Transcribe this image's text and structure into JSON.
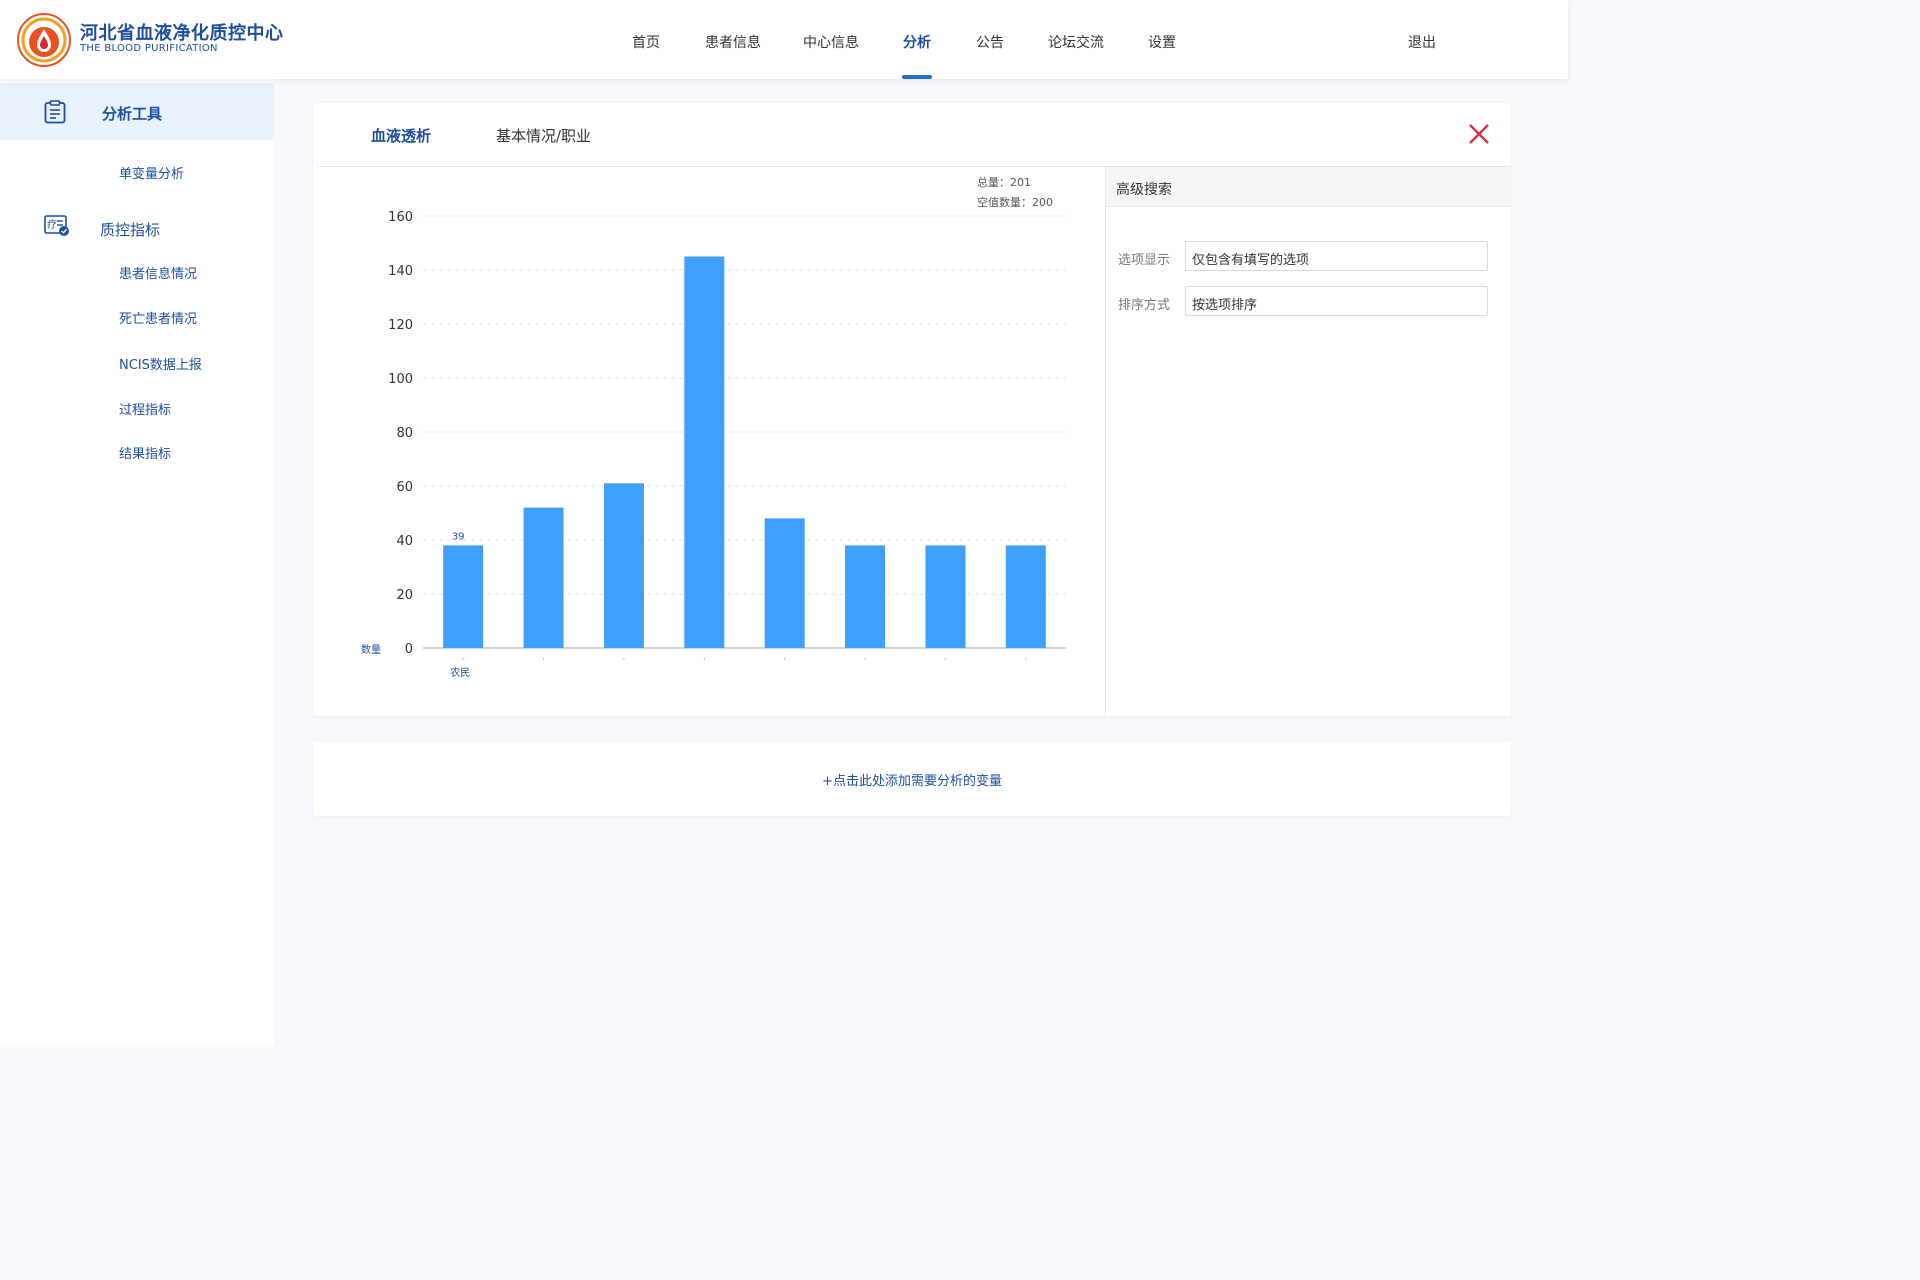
{
  "brand": {
    "name_cn": "河北省血液净化质控中心",
    "name_en": "THE BLOOD PURIFICATION"
  },
  "nav": {
    "items": [
      {
        "label": "首页"
      },
      {
        "label": "患者信息"
      },
      {
        "label": "中心信息"
      },
      {
        "label": "分析"
      },
      {
        "label": "公告"
      },
      {
        "label": "论坛交流"
      },
      {
        "label": "设置"
      }
    ],
    "active": "分析",
    "logout": "退出"
  },
  "sidebar": {
    "tools_title": "分析工具",
    "tools_items": [
      {
        "label": "单变量分析"
      }
    ],
    "qc_title": "质控指标",
    "qc_items": [
      {
        "label": "患者信息情况"
      },
      {
        "label": "死亡患者情况"
      },
      {
        "label": "NCIS数据上报"
      },
      {
        "label": "过程指标"
      },
      {
        "label": "结果指标"
      }
    ]
  },
  "card": {
    "tabs": [
      {
        "label": "血液透析"
      },
      {
        "label": "基本情况/职业"
      }
    ],
    "active_tab": "血液透析",
    "stats": {
      "total": "总量：201",
      "empty": "空值数量：200"
    }
  },
  "advanced_search": {
    "title": "高级搜索",
    "option_display_label": "选项显示",
    "option_display_value": "仅包含有填写的选项",
    "sort_label": "排序方式",
    "sort_value": "按选项排序"
  },
  "add_variable_label": "+点击此处添加需要分析的变量",
  "colors": {
    "primary": "#1d4e9e",
    "bar": "#3f9fff",
    "close": "#d9303f"
  },
  "chart_data": {
    "type": "bar",
    "ylabel": "数量",
    "ylim": [
      0,
      160
    ],
    "yticks": [
      0,
      20,
      40,
      60,
      80,
      100,
      120,
      140,
      160
    ],
    "categories": [
      "农民",
      "",
      "",
      "",
      "",
      "",
      "",
      ""
    ],
    "values": [
      38,
      52,
      61,
      145,
      48,
      38,
      38,
      38
    ],
    "data_labels": [
      "39",
      "",
      "",
      "",
      "",
      "",
      "",
      ""
    ],
    "grid": true
  }
}
